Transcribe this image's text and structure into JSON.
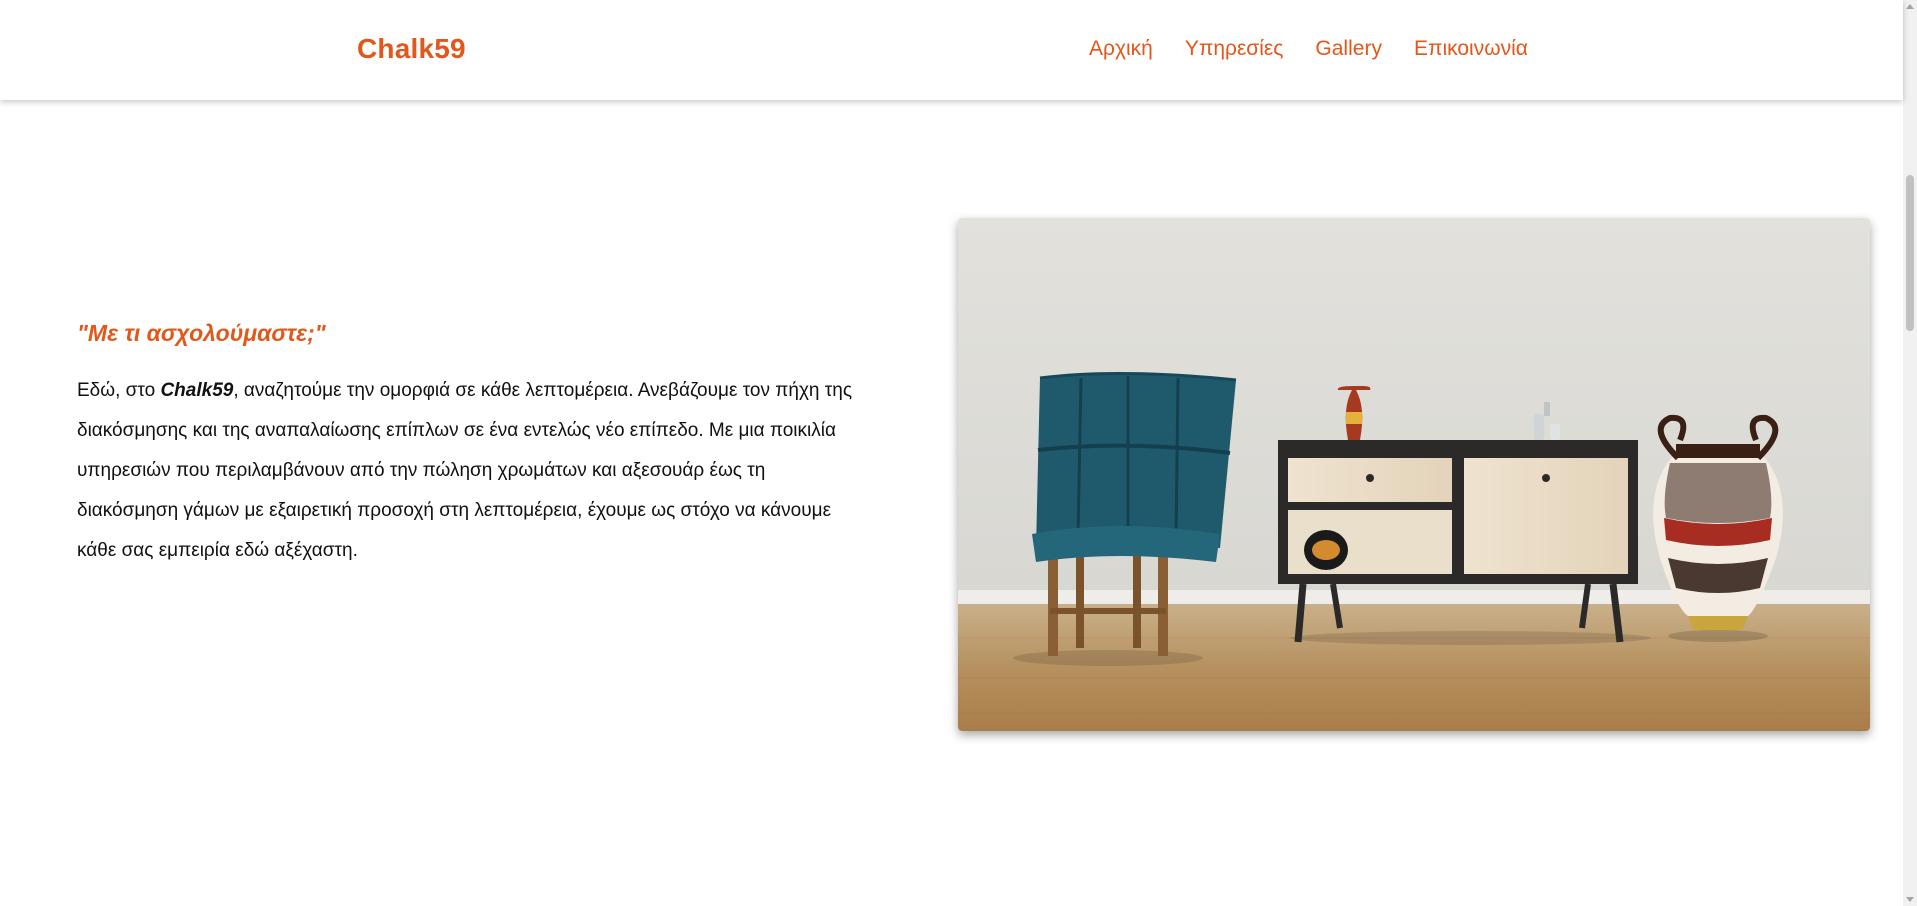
{
  "header": {
    "brand": "Chalk59",
    "nav": [
      "Αρχική",
      "Υπηρεσίες",
      "Gallery",
      "Επικοινωνία"
    ]
  },
  "intro": {
    "heading": "\"Με τι ασχολούμαστε;\"",
    "body_prefix": "Εδώ, στο ",
    "body_brand": "Chalk59",
    "body_rest": ", αναζητούμε την ομορφιά σε κάθε λεπτομέρεια. Ανεβάζουμε τον πήχη της διακόσμησης και της αναπαλαίωσης επίπλων σε ένα εντελώς νέο επίπεδο. Με μια ποικιλία υπηρεσιών που περιλαμβάνουν από την πώληση χρωμάτων και αξεσουάρ έως τη διακόσμηση γάμων με εξαιρετική προσοχή στη λεπτομέρεια, έχουμε ως στόχο να κάνουμε κάθε σας εμπειρία εδώ αξέχαστη."
  },
  "colors": {
    "accent": "#e2571a",
    "text": "#111111",
    "header_bg": "#ffffff"
  }
}
